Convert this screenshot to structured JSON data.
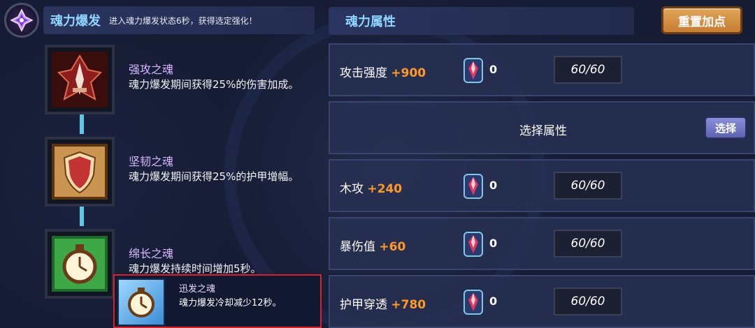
{
  "burst": {
    "title": "魂力爆发",
    "description": "进入魂力爆发状态6秒，获得选定强化！",
    "emblem_icon": "purple-crystal-emblem-icon"
  },
  "skills": [
    {
      "name": "强攻之魂",
      "description": "魂力爆发期间获得25%的伤害加成。",
      "icon": "red-sword-soul-icon"
    },
    {
      "name": "坚韧之魂",
      "description": "魂力爆发期间获得25%的护甲增幅。",
      "icon": "shield-soul-icon"
    },
    {
      "name": "绵长之魂",
      "description": "魂力爆发持续时间增加5秒。",
      "icon": "green-clock-soul-icon"
    }
  ],
  "highlighted_skill": {
    "name": "迅发之魂",
    "description": "魂力爆发冷却减少12秒。",
    "icon": "blue-clock-soul-icon"
  },
  "attributes": {
    "title": "魂力属性",
    "reset_label": "重置加点",
    "rows": [
      {
        "label": "攻击强度",
        "bonus": "+900",
        "count": "0",
        "cap": "60/60",
        "gem_icon": "soul-gem-icon"
      },
      {
        "select_label": "选择属性",
        "button_label": "选择"
      },
      {
        "label": "木攻",
        "bonus": "+240",
        "count": "0",
        "cap": "60/60",
        "gem_icon": "soul-gem-icon"
      },
      {
        "label": "暴伤值",
        "bonus": "+60",
        "count": "0",
        "cap": "60/60",
        "gem_icon": "soul-gem-icon"
      },
      {
        "label": "护甲穿透",
        "bonus": "+780",
        "count": "0",
        "cap": "60/60",
        "gem_icon": "soul-gem-icon"
      }
    ]
  },
  "colors": {
    "accent_title": "#8fd6ff",
    "bonus": "#ff9a2a",
    "highlight_border": "#d6222a",
    "reset_button": "#d08a3e",
    "select_button": "#7378c6"
  }
}
